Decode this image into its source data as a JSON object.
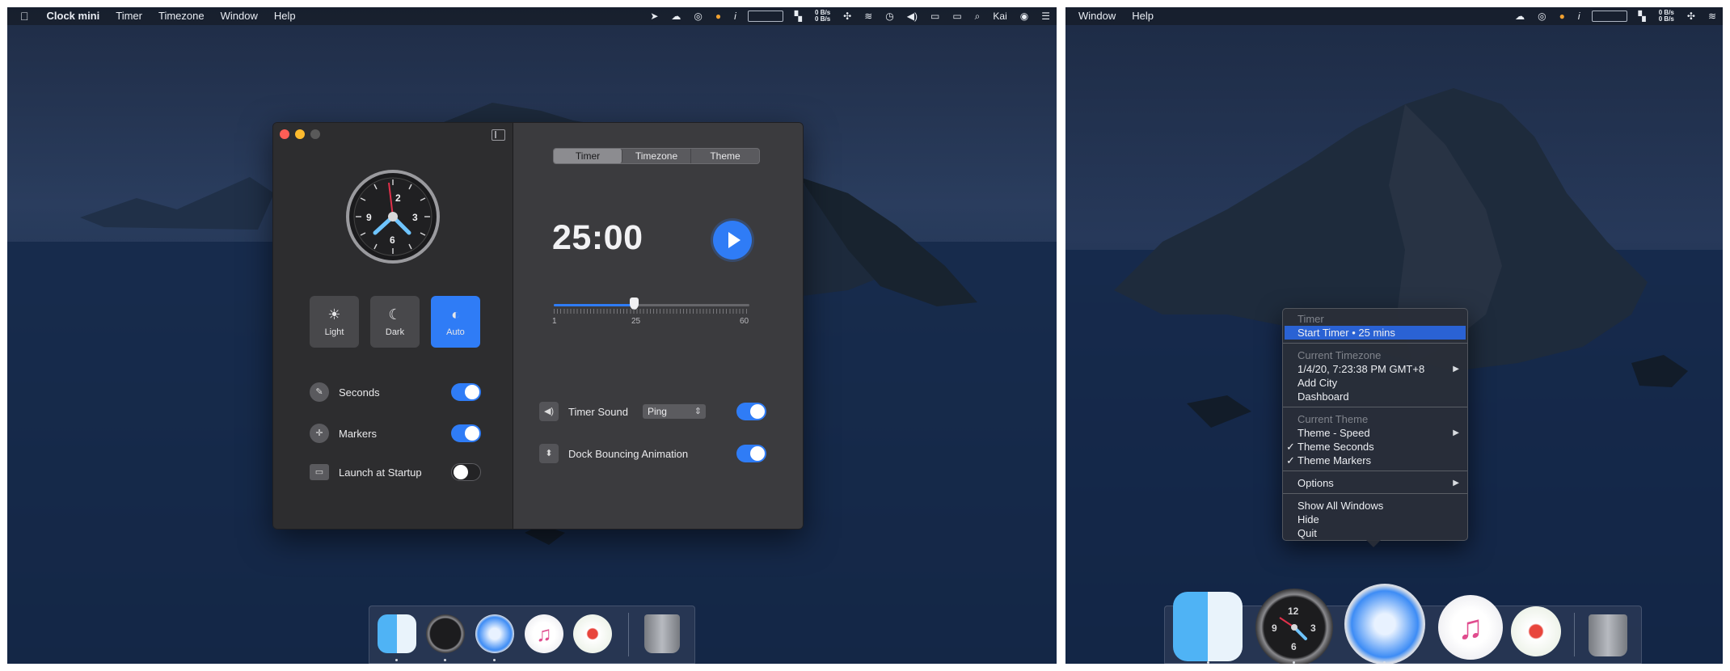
{
  "left": {
    "menubar": {
      "apple": "",
      "app_name": "Clock mini",
      "items": [
        "Timer",
        "Timezone",
        "Window",
        "Help"
      ],
      "net_up": "0 B/s",
      "net_down": "0 B/s",
      "user": "Kai"
    },
    "window": {
      "theme_buttons": [
        "Light",
        "Dark",
        "Auto"
      ],
      "active_theme": "Auto",
      "settings": [
        {
          "label": "Seconds",
          "on": true
        },
        {
          "label": "Markers",
          "on": true
        },
        {
          "label": "Launch at Startup",
          "on": false
        }
      ],
      "tabs": [
        "Timer",
        "Timezone",
        "Theme"
      ],
      "active_tab": "Timer",
      "timer_display": "25:00",
      "slider": {
        "min": "1",
        "value": "25",
        "max": "60",
        "fraction": 0.41
      },
      "timer_sound_label": "Timer Sound",
      "timer_sound_value": "Ping",
      "timer_sound_on": true,
      "dock_bounce_label": "Dock Bouncing Animation",
      "dock_bounce_on": true
    },
    "clock_numbers": [
      "2",
      "3",
      "6",
      "9"
    ]
  },
  "right": {
    "menubar": {
      "items": [
        "Window",
        "Help"
      ],
      "net_up": "0 B/s",
      "net_down": "0 B/s"
    },
    "context_menu": {
      "timer_header": "Timer",
      "start_timer": "Start Timer",
      "start_timer_duration": "25 mins",
      "timezone_header": "Current Timezone",
      "current_time": "1/4/20, 7:23:38 PM GMT+8",
      "add_city": "Add City",
      "dashboard": "Dashboard",
      "theme_header": "Current Theme",
      "theme_speed": "Theme - Speed",
      "theme_seconds": "Theme Seconds",
      "theme_markers": "Theme Markers",
      "options": "Options",
      "show_all_windows": "Show All Windows",
      "hide": "Hide",
      "quit": "Quit"
    },
    "clock_numbers": [
      "12",
      "3",
      "6",
      "9"
    ]
  },
  "colors": {
    "accent": "#2f7cf6",
    "menu_highlight": "#2a62d4",
    "pane_dark": "#2d2d2f",
    "pane_light": "#3b3b3e"
  },
  "icons": [
    "apple-icon",
    "location-icon",
    "wifi-icon",
    "volume-icon",
    "battery-icon",
    "search-icon",
    "control-center-icon",
    "sun-icon",
    "moon-icon",
    "auto-theme-icon",
    "play-icon",
    "finder-icon",
    "clock-mini-icon",
    "safari-icon",
    "music-icon",
    "flower-icon",
    "trash-icon"
  ]
}
